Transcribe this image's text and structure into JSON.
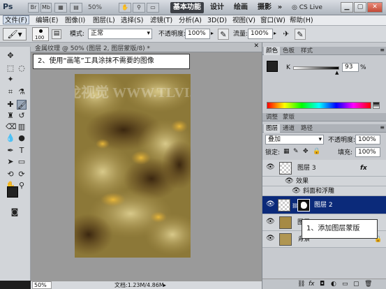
{
  "titlebar": {
    "logo": "Ps",
    "br_label": "Br",
    "mb_label": "Mb",
    "zoom": "50%",
    "workspaces": [
      "基本功能",
      "设计",
      "绘画",
      "摄影"
    ],
    "more": "»",
    "cs_live": "CS Live"
  },
  "menubar": {
    "items": [
      "文件(F)",
      "编辑(E)",
      "图像(I)",
      "图层(L)",
      "选择(S)",
      "滤镜(T)",
      "分析(A)",
      "3D(D)",
      "视图(V)",
      "窗口(W)",
      "帮助(H)"
    ]
  },
  "options": {
    "brush_size": "100",
    "mode_label": "模式:",
    "mode_value": "正常",
    "opacity_label": "不透明度:",
    "opacity_value": "100%",
    "flow_label": "流量:",
    "flow_value": "100%"
  },
  "document": {
    "tab_title": "金属纹理 @ 50% (图层 2, 图层蒙版/8) *",
    "watermark": "腾龙视觉 WWW.TLVI.NET",
    "zoom": "50%",
    "doc_info": "文档:1.23M/4.86M"
  },
  "callouts": {
    "step2": "2、使用“画笔”工具涂抹不需要的图像",
    "step1": "1、添加图层蒙版"
  },
  "color_panel": {
    "tabs": [
      "颜色",
      "色板",
      "样式"
    ],
    "k_label": "K",
    "k_value": "93",
    "k_unit": "%"
  },
  "adjust_panel": {
    "tabs": [
      "调整",
      "蒙版"
    ]
  },
  "layers_panel": {
    "tabs": [
      "图层",
      "通道",
      "路径"
    ],
    "blend_mode": "叠加",
    "opacity_label": "不透明度:",
    "opacity_value": "100%",
    "lock_label": "锁定:",
    "fill_label": "填充:",
    "fill_value": "100%",
    "layers": [
      {
        "name": "图层 3",
        "fx": "fx"
      },
      {
        "name": "效果"
      },
      {
        "name": "斜面和浮雕"
      },
      {
        "name": "图层 2"
      },
      {
        "name": "图层 1"
      },
      {
        "name": "背景"
      }
    ]
  },
  "colors": {
    "accent": "#0b2a7a",
    "foreground": "#222222",
    "background": "#ffffff"
  }
}
